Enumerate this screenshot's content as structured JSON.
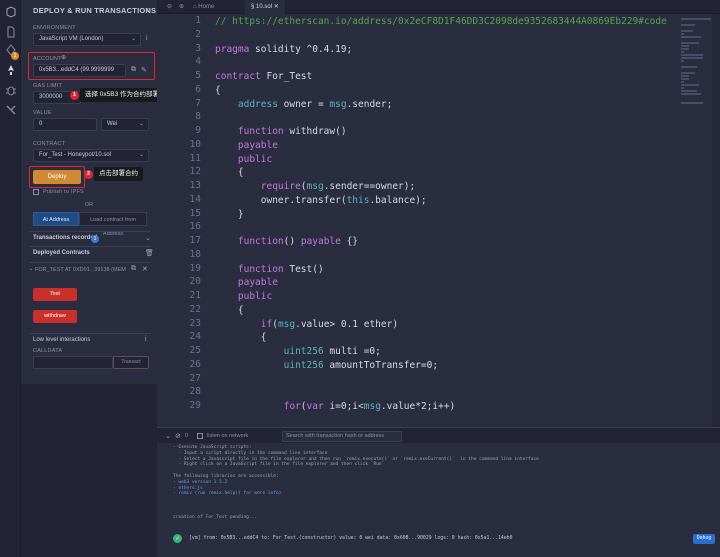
{
  "icon_bar": {
    "items": [
      "file-icon",
      "compile-icon",
      "deploy-icon",
      "debug-icon",
      "settings-icon"
    ],
    "badge": "1"
  },
  "panel": {
    "title": "DEPLOY & RUN TRANSACTIONS",
    "environment_label": "ENVIRONMENT",
    "environment_value": "JavaScript VM (London)",
    "account_label": "ACCOUNT",
    "account_value": "0x5B3...eddC4 (99.9999999",
    "gas_limit_label": "GAS LIMIT",
    "gas_limit_value": "3000000",
    "value_label": "VALUE",
    "value_value": "0",
    "value_unit": "Wei",
    "contract_label": "CONTRACT",
    "contract_value": "For_Test - Honeypot/10.sol",
    "deploy_label": "Deploy",
    "publish_label": "Publish to IPFS",
    "or_label": "OR",
    "at_address_label": "At Address",
    "load_label": "Load contract from Address",
    "transactions_label": "Transactions recorded",
    "transactions_count": "1",
    "deployed_label": "Deployed Contracts",
    "instance_label": "FOR_TEST AT 0XD91...39138 (MEM",
    "fn_test_label": "Test",
    "fn_withdraw_label": "withdraw",
    "low_level_label": "Low level interactions",
    "calldata_label": "CALLDATA",
    "transact_label": "Transact"
  },
  "callouts": [
    {
      "num": "1",
      "text": "选择 0x5B3 作为合约部署者"
    },
    {
      "num": "2",
      "text": "点击部署合约"
    }
  ],
  "tabs": {
    "home": "Home",
    "file": "10.sol"
  },
  "code": {
    "line_numbers": [
      "1",
      "2",
      "3",
      "4",
      "5",
      "6",
      "7",
      "8",
      "9",
      "10",
      "11",
      "12",
      "13",
      "14",
      "15",
      "16",
      "17",
      "18",
      "19",
      "20",
      "21",
      "22",
      "23",
      "24",
      "25",
      "26",
      "27",
      "28",
      "29"
    ],
    "lines": {
      "l1": "// https://etherscan.io/address/0x2eCF8D1F46DD3C2098de9352683444A0869Eb229#code",
      "l3a": "pragma",
      "l3b": " solidity ^0.4.19;",
      "l5a": "contract",
      "l5b": " For_Test",
      "l6": "{",
      "l7a": "    address",
      "l7b": " owner = ",
      "l7c": "msg",
      "l7d": ".sender;",
      "l9a": "    function",
      "l9b": " withdraw()",
      "l10": "    payable",
      "l11": "    public",
      "l12": "    {",
      "l13a": "        require",
      "l13b": "(",
      "l13c": "msg",
      "l13d": ".sender==owner);",
      "l14a": "        owner.transfer(",
      "l14b": "this",
      "l14c": ".balance);",
      "l15": "    }",
      "l17a": "    function",
      "l17b": "() ",
      "l17c": "payable",
      "l17d": " {}",
      "l19a": "    function",
      "l19b": " Test()",
      "l20": "    payable",
      "l21": "    public",
      "l22": "    {",
      "l23a": "        if",
      "l23b": "(",
      "l23c": "msg",
      "l23d": ".value> 0.1 ether)",
      "l24": "        {",
      "l25a": "            uint256",
      "l25b": " multi =0;",
      "l26a": "            uint256",
      "l26b": " amountToTransfer=0;",
      "l29a": "            for",
      "l29b": "(",
      "l29c": "var",
      "l29d": " i=0;i<",
      "l29e": "msg",
      "l29f": ".value*2;i++)"
    }
  },
  "terminal": {
    "listen_label": "listen on network",
    "count": "0",
    "search_placeholder": "Search with transaction hash or address",
    "lines": [
      "- Execute JavaScript scripts:",
      "  - Input a script directly in the command line interface",
      "  - Select a Javascript file in the file explorer and then run `remix.execute()` or `remix.exeCurrent()`  in the command line interface",
      "  - Right click on a JavaScript file in the file explorer and then click `Run`",
      "",
      "The following libraries are accessible:",
      "- web3 version 1.5.2",
      "- ethers.js",
      "- remix (run remix.help() for more info)",
      "",
      "",
      "",
      "creation of For_Test pending..."
    ],
    "tx_line": "[vm]  from: 0x5B3...eddC4 to: For_Test.(constructor) value: 0 wei data: 0x608...90029 logs: 0 hash: 0x5a1...14eb0",
    "debug_label": "Debug"
  }
}
